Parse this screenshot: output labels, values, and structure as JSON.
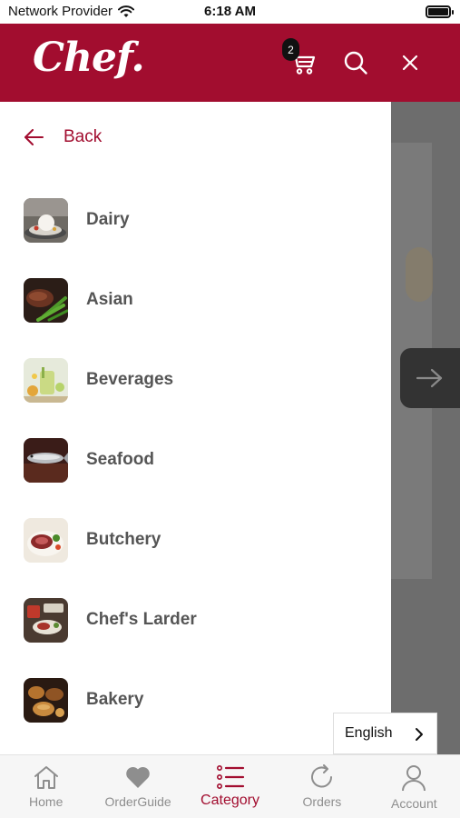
{
  "status_bar": {
    "carrier": "Network Provider",
    "time": "6:18 AM"
  },
  "header": {
    "logo": "Chef.",
    "cart_count": "2"
  },
  "drawer": {
    "back_label": "Back",
    "categories": [
      {
        "label": "Dairy",
        "thumb": "dairy-thumbnail"
      },
      {
        "label": "Asian",
        "thumb": "asian-thumbnail"
      },
      {
        "label": "Beverages",
        "thumb": "beverages-thumbnail"
      },
      {
        "label": "Seafood",
        "thumb": "seafood-thumbnail"
      },
      {
        "label": "Butchery",
        "thumb": "butchery-thumbnail"
      },
      {
        "label": "Chef's Larder",
        "thumb": "chefs-larder-thumbnail"
      },
      {
        "label": "Bakery",
        "thumb": "bakery-thumbnail"
      }
    ]
  },
  "language": {
    "selected": "English"
  },
  "bottom_nav": {
    "items": [
      {
        "label": "Home",
        "icon": "home-icon"
      },
      {
        "label": "OrderGuide",
        "icon": "heart-icon"
      },
      {
        "label": "Category",
        "icon": "list-icon",
        "active": true
      },
      {
        "label": "Orders",
        "icon": "refresh-icon"
      },
      {
        "label": "Account",
        "icon": "user-icon"
      }
    ]
  },
  "colors": {
    "brand": "#a20d2f",
    "overlay": "#6d6d6d",
    "nav_inactive": "#8e8e8e"
  }
}
